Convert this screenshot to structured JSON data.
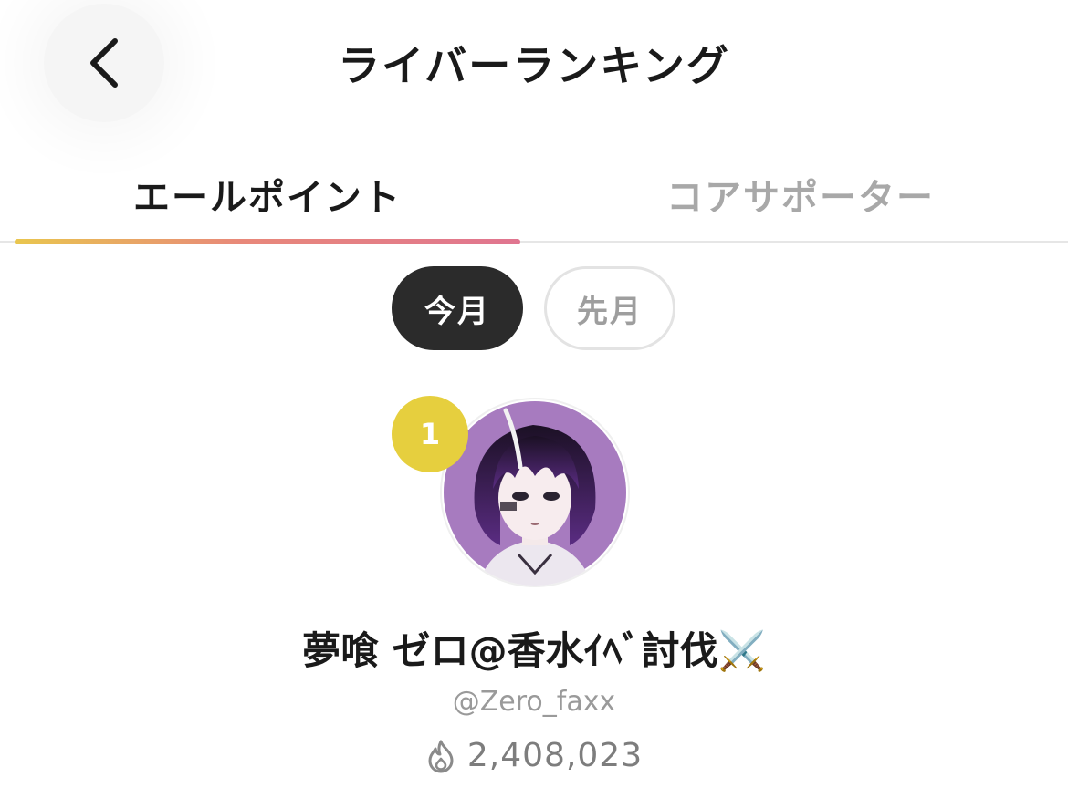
{
  "header": {
    "title": "ライバーランキング",
    "back_icon": "chevron-left-icon"
  },
  "tabs": [
    {
      "label": "エールポイント",
      "active": true
    },
    {
      "label": "コアサポーター",
      "active": false
    }
  ],
  "period_toggle": {
    "options": [
      {
        "label": "今月",
        "selected": true
      },
      {
        "label": "先月",
        "selected": false
      }
    ]
  },
  "ranking": [
    {
      "rank": "1",
      "display_name": "夢喰 ゼロ@香水ｲﾍﾞ討伐⚔️",
      "username": "@Zero_faxx",
      "points": "2,408,023",
      "points_icon": "flame-icon"
    }
  ],
  "colors": {
    "rank_badge": "#e6cf3e",
    "tab_indicator_start": "#e9c64e",
    "tab_indicator_end": "#e07590",
    "selected_pill": "#2b2b2b",
    "avatar_bg": "#a77bbf"
  }
}
